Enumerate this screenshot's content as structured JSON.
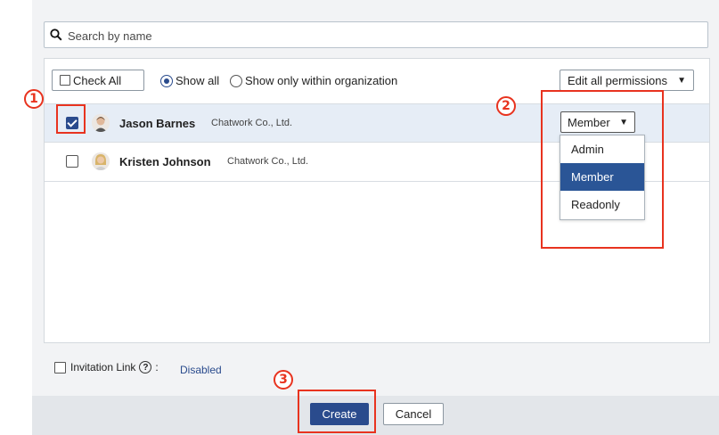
{
  "search": {
    "placeholder": "Search by name",
    "icon": "search-icon"
  },
  "toolbar": {
    "check_all_label": "Check All",
    "radio_show_all": "Show all",
    "radio_show_org": "Show only within organization",
    "edit_all_label": "Edit all permissions",
    "edit_all_arrow": "▼"
  },
  "members": [
    {
      "name": "Jason Barnes",
      "org": "Chatwork Co., Ltd.",
      "checked": true,
      "permission": "Member",
      "arrow": "▼"
    },
    {
      "name": "Kristen Johnson",
      "org": "Chatwork Co., Ltd.",
      "checked": false
    }
  ],
  "permission_menu": {
    "options": [
      "Admin",
      "Member",
      "Readonly"
    ],
    "selected": "Member"
  },
  "invitation": {
    "label": "Invitation Link",
    "help": "?",
    "colon": ":",
    "status": "Disabled"
  },
  "footer": {
    "create_label": "Create",
    "cancel_label": "Cancel"
  },
  "annotations": {
    "m1": "1",
    "m2": "2",
    "m3": "3"
  },
  "colors": {
    "accent": "#2a4b8d",
    "highlight": "#e8331f",
    "selected_row": "#e6edf6"
  }
}
